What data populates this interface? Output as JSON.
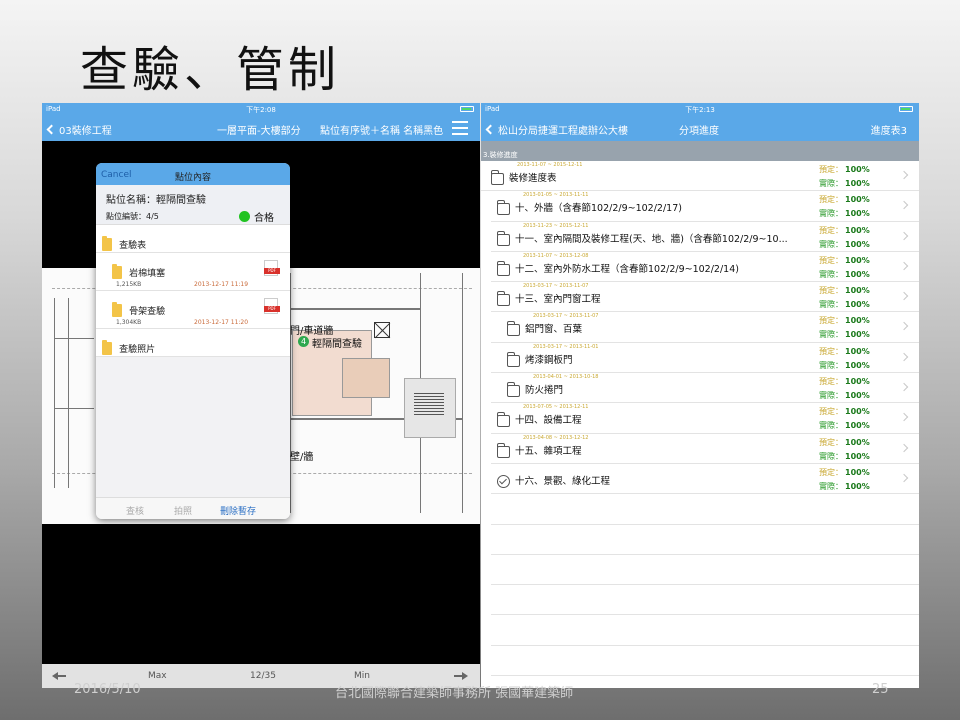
{
  "slide": {
    "title": "查驗、管制",
    "footer_date": "2016/5/10",
    "footer_org": "台北國際聯合建築師事務所 張國華建築師",
    "footer_page": "25"
  },
  "left_pad": {
    "status": {
      "device": "iPad",
      "time": "下午2:08"
    },
    "nav": {
      "back_label": "03裝修工程",
      "title": "一層平面-大樓部分",
      "right_label": "點位有序號＋名稱 名稱黑色"
    },
    "popover": {
      "cancel_label": "Cancel",
      "title": "點位內容",
      "point_name": "點位名稱：輕隔間查驗",
      "point_number": "點位編號：4/5",
      "status_label": "合格",
      "status_color": "#21c321",
      "items": [
        {
          "type": "folder",
          "label": "查驗表"
        },
        {
          "type": "file",
          "label": "岩棉填塞",
          "size": "1,215KB",
          "date": "2013-12-17 11:19"
        },
        {
          "type": "file",
          "label": "骨架查驗",
          "size": "1,304KB",
          "date": "2013-12-17 11:20"
        },
        {
          "type": "folder",
          "label": "查驗照片"
        }
      ],
      "footer": {
        "check_label": "查核",
        "photo_label": "拍照",
        "delete_label": "刪除暫存"
      }
    },
    "blueprint": {
      "label_door": "門/車道牆",
      "label_point": "輕隔間查驗",
      "point_number": "4",
      "label_wall": "壁/牆"
    },
    "bottom": {
      "max_label": "Max",
      "page": "12/35",
      "min_label": "Min"
    }
  },
  "right_pad": {
    "status": {
      "device": "iPad",
      "time": "下午2:13"
    },
    "nav": {
      "back_label": "松山分局捷運工程處辦公大樓",
      "title": "分項進度",
      "right_label": "進度表3"
    },
    "section": "3.裝修進度",
    "plan_label": "預定：",
    "actual_label": "實際：",
    "rows": [
      {
        "indent": 0,
        "icon": "folder",
        "label": "裝修進度表",
        "dates": "2013-11-07 ~ 2015-12-11",
        "plan": "100%",
        "actual": "100%"
      },
      {
        "indent": 1,
        "icon": "folder",
        "label": "十、外牆（含春節102/2/9~102/2/17)",
        "dates": "2013-01-05 ~ 2013-11-11",
        "plan": "100%",
        "actual": "100%"
      },
      {
        "indent": 1,
        "icon": "folder",
        "label": "十一、室內隔間及裝修工程(天、地、牆)（含春節102/2/9~10...",
        "dates": "2013-11-23 ~ 2015-12-11",
        "plan": "100%",
        "actual": "100%"
      },
      {
        "indent": 1,
        "icon": "folder",
        "label": "十二、室內外防水工程（含春節102/2/9~102/2/14)",
        "dates": "2013-11-07 ~ 2013-12-08",
        "plan": "100%",
        "actual": "100%"
      },
      {
        "indent": 1,
        "icon": "folder",
        "label": "十三、室內門窗工程",
        "dates": "2013-03-17 ~ 2013-11-07",
        "plan": "100%",
        "actual": "100%"
      },
      {
        "indent": 2,
        "icon": "folder",
        "label": "鋁門窗、百葉",
        "dates": "2013-03-17 ~ 2013-11-07",
        "plan": "100%",
        "actual": "100%"
      },
      {
        "indent": 2,
        "icon": "folder",
        "label": "烤漆鋼板門",
        "dates": "2013-03-17 ~ 2013-11-01",
        "plan": "100%",
        "actual": "100%"
      },
      {
        "indent": 2,
        "icon": "folder",
        "label": "防火捲門",
        "dates": "2013-04-01 ~ 2013-10-18",
        "plan": "100%",
        "actual": "100%"
      },
      {
        "indent": 1,
        "icon": "folder",
        "label": "十四、設備工程",
        "dates": "2013-07-05 ~ 2013-12-11",
        "plan": "100%",
        "actual": "100%"
      },
      {
        "indent": 1,
        "icon": "folder",
        "label": "十五、雜項工程",
        "dates": "2013-04-08 ~ 2013-12-12",
        "plan": "100%",
        "actual": "100%"
      },
      {
        "indent": 1,
        "icon": "check",
        "label": "十六、景觀、綠化工程",
        "dates": "",
        "plan": "100%",
        "actual": "100%"
      }
    ]
  }
}
